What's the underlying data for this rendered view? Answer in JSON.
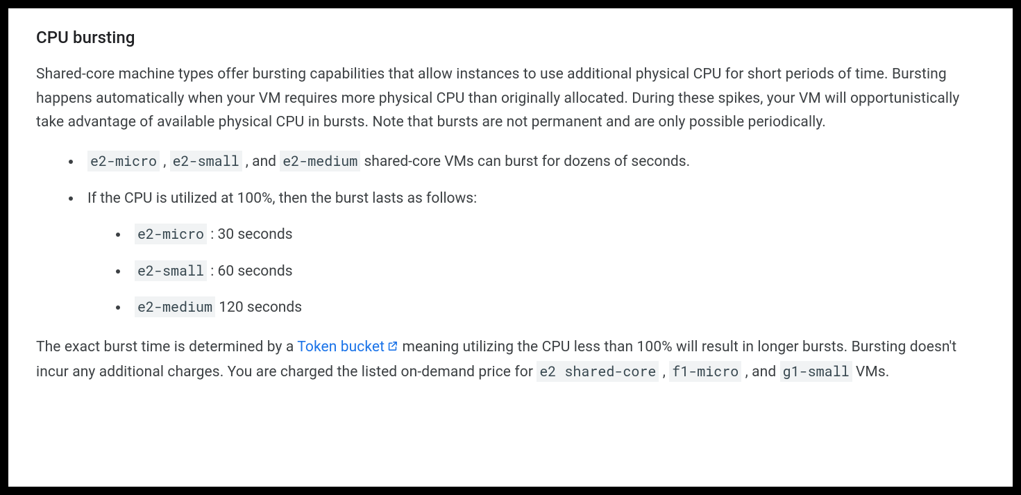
{
  "heading": "CPU bursting",
  "para1": "Shared-core machine types offer bursting capabilities that allow instances to use additional physical CPU for short periods of time. Bursting happens automatically when your VM requires more physical CPU than originally allocated. During these spikes, your VM will opportunistically take advantage of available physical CPU in bursts. Note that bursts are not permanent and are only possible periodically.",
  "bullet1": {
    "code1": "e2-micro",
    "sep1": " , ",
    "code2": "e2-small",
    "sep2": " , and ",
    "code3": "e2-medium",
    "tail": " shared-core VMs can burst for dozens of seconds."
  },
  "bullet2_intro": "If the CPU is utilized at 100%, then the burst lasts as follows:",
  "burst_list": [
    {
      "code": "e2-micro",
      "sep": " : ",
      "value": "30 seconds"
    },
    {
      "code": "e2-small",
      "sep": " : ",
      "value": "60 seconds"
    },
    {
      "code": "e2-medium",
      "sep": " ",
      "value": "120 seconds"
    }
  ],
  "para2": {
    "a": "The exact burst time is determined by a ",
    "link": "Token bucket",
    "b": " meaning utilizing the CPU less than 100% will result in longer bursts. Bursting doesn't incur any additional charges. You are charged the listed on-demand price for ",
    "code1": "e2 shared-core",
    "c": " , ",
    "code2": "f1-micro",
    "d": " , and ",
    "code3": "g1-small",
    "e": " VMs."
  }
}
